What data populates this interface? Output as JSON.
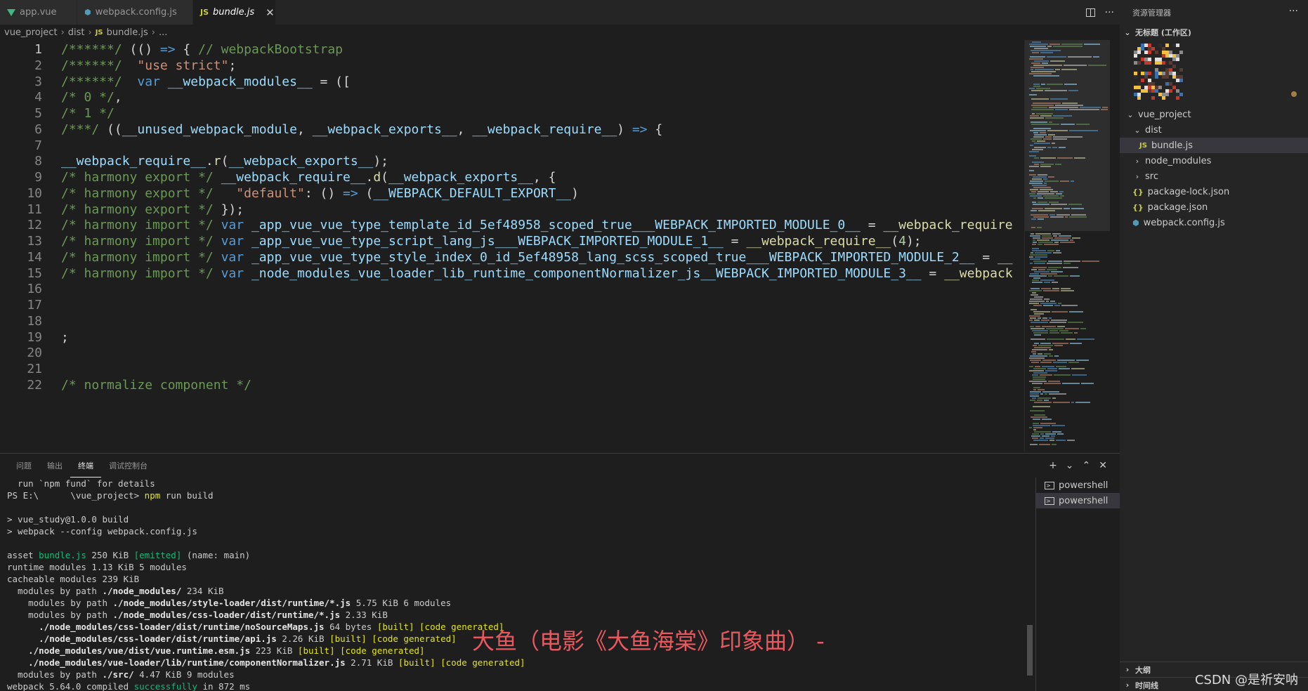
{
  "tabs": [
    {
      "label": "app.vue",
      "icon": "vue-icon",
      "active": false
    },
    {
      "label": "webpack.config.js",
      "icon": "webpack-icon",
      "active": false
    },
    {
      "label": "bundle.js",
      "icon": "js-icon",
      "active": true
    }
  ],
  "tab_actions": {
    "close_glyph": "✕",
    "more_glyph": "···"
  },
  "breadcrumb": {
    "items": [
      "vue_project",
      "dist",
      "bundle.js",
      "..."
    ],
    "file_icon": "JS",
    "sep": "›"
  },
  "editor": {
    "lines": [
      {
        "n": "1",
        "tokens": [
          [
            "cm",
            "/******/ "
          ],
          [
            "op",
            "(() "
          ],
          [
            "kw",
            "=>"
          ],
          [
            "op",
            " { "
          ],
          [
            "cm",
            "// webpackBootstrap"
          ]
        ]
      },
      {
        "n": "2",
        "tokens": [
          [
            "cm",
            "/******/ "
          ],
          [
            "op",
            " "
          ],
          [
            "str",
            "\"use strict\""
          ],
          [
            "op",
            ";"
          ]
        ]
      },
      {
        "n": "3",
        "tokens": [
          [
            "cm",
            "/******/ "
          ],
          [
            "op",
            " "
          ],
          [
            "kw",
            "var"
          ],
          [
            "op",
            " "
          ],
          [
            "var",
            "__webpack_modules__"
          ],
          [
            "op",
            " = (["
          ]
        ]
      },
      {
        "n": "4",
        "tokens": [
          [
            "cm",
            "/* 0 */"
          ],
          [
            "op",
            ","
          ]
        ]
      },
      {
        "n": "5",
        "tokens": [
          [
            "cm",
            "/* 1 */"
          ]
        ]
      },
      {
        "n": "6",
        "tokens": [
          [
            "cm",
            "/***/ "
          ],
          [
            "op",
            "(("
          ],
          [
            "var",
            "__unused_webpack_module"
          ],
          [
            "op",
            ", "
          ],
          [
            "var",
            "__webpack_exports__"
          ],
          [
            "op",
            ", "
          ],
          [
            "var",
            "__webpack_require__"
          ],
          [
            "op",
            ") "
          ],
          [
            "kw",
            "=>"
          ],
          [
            "op",
            " {"
          ]
        ]
      },
      {
        "n": "7",
        "tokens": []
      },
      {
        "n": "8",
        "tokens": [
          [
            "var",
            "__webpack_require__"
          ],
          [
            "op",
            "."
          ],
          [
            "fn",
            "r"
          ],
          [
            "op",
            "("
          ],
          [
            "var",
            "__webpack_exports__"
          ],
          [
            "op",
            ");"
          ]
        ]
      },
      {
        "n": "9",
        "tokens": [
          [
            "cm",
            "/* harmony export */ "
          ],
          [
            "var",
            "__webpack_require__"
          ],
          [
            "op",
            "."
          ],
          [
            "fn",
            "d"
          ],
          [
            "op",
            "("
          ],
          [
            "var",
            "__webpack_exports__"
          ],
          [
            "op",
            ", {"
          ]
        ]
      },
      {
        "n": "10",
        "tokens": [
          [
            "cm",
            "/* harmony export */ "
          ],
          [
            "op",
            "  "
          ],
          [
            "str",
            "\"default\""
          ],
          [
            "op",
            ": () "
          ],
          [
            "kw",
            "=>"
          ],
          [
            "op",
            " ("
          ],
          [
            "var",
            "__WEBPACK_DEFAULT_EXPORT__"
          ],
          [
            "op",
            ")"
          ]
        ]
      },
      {
        "n": "11",
        "tokens": [
          [
            "cm",
            "/* harmony export */ "
          ],
          [
            "op",
            "});"
          ]
        ]
      },
      {
        "n": "12",
        "tokens": [
          [
            "cm",
            "/* harmony import */ "
          ],
          [
            "kw",
            "var"
          ],
          [
            "op",
            " "
          ],
          [
            "var",
            "_app_vue_vue_type_template_id_5ef48958_scoped_true___WEBPACK_IMPORTED_MODULE_0__"
          ],
          [
            "op",
            " = "
          ],
          [
            "fn",
            "__webpack_require"
          ]
        ]
      },
      {
        "n": "13",
        "tokens": [
          [
            "cm",
            "/* harmony import */ "
          ],
          [
            "kw",
            "var"
          ],
          [
            "op",
            " "
          ],
          [
            "var",
            "_app_vue_vue_type_script_lang_js___WEBPACK_IMPORTED_MODULE_1__"
          ],
          [
            "op",
            " = "
          ],
          [
            "fn",
            "__webpack_require__"
          ],
          [
            "op",
            "("
          ],
          [
            "num",
            "4"
          ],
          [
            "op",
            ");"
          ]
        ]
      },
      {
        "n": "14",
        "tokens": [
          [
            "cm",
            "/* harmony import */ "
          ],
          [
            "kw",
            "var"
          ],
          [
            "op",
            " "
          ],
          [
            "var",
            "_app_vue_vue_type_style_index_0_id_5ef48958_lang_scss_scoped_true___WEBPACK_IMPORTED_MODULE_2__"
          ],
          [
            "op",
            " = "
          ],
          [
            "fn",
            "__"
          ]
        ]
      },
      {
        "n": "15",
        "tokens": [
          [
            "cm",
            "/* harmony import */ "
          ],
          [
            "kw",
            "var"
          ],
          [
            "op",
            " "
          ],
          [
            "var",
            "_node_modules_vue_loader_lib_runtime_componentNormalizer_js__WEBPACK_IMPORTED_MODULE_3__"
          ],
          [
            "op",
            " = "
          ],
          [
            "fn",
            "__webpack"
          ]
        ]
      },
      {
        "n": "16",
        "tokens": []
      },
      {
        "n": "17",
        "tokens": []
      },
      {
        "n": "18",
        "tokens": []
      },
      {
        "n": "19",
        "tokens": [
          [
            "op",
            ";"
          ]
        ]
      },
      {
        "n": "20",
        "tokens": []
      },
      {
        "n": "21",
        "tokens": []
      },
      {
        "n": "22",
        "tokens": [
          [
            "cm",
            "/* normalize component */"
          ]
        ]
      }
    ]
  },
  "panel": {
    "tabs": [
      "问题",
      "输出",
      "终端",
      "调试控制台"
    ],
    "active_tab": "终端",
    "actions": [
      "+",
      "⌄",
      "⌃",
      "✕"
    ],
    "terminal_lines": [
      [
        [
          "n",
          "  run `npm fund` for details"
        ]
      ]
    ],
    "terminal": [
      [
        [
          "n",
          "  run `npm fund` for details"
        ]
      ],
      [
        [
          "n",
          "PS E:\\"
        ],
        [
          "n",
          "      "
        ],
        [
          "n",
          "\\vue_project> "
        ],
        [
          "y",
          "npm"
        ],
        [
          "n",
          " run build"
        ]
      ],
      [
        [
          "n",
          ""
        ]
      ],
      [
        [
          "n",
          "> vue_study@1.0.0 build"
        ]
      ],
      [
        [
          "n",
          "> webpack --config webpack.config.js"
        ]
      ],
      [
        [
          "n",
          ""
        ]
      ],
      [
        [
          "n",
          "asset "
        ],
        [
          "g",
          "bundle.js"
        ],
        [
          "n",
          " 250 KiB "
        ],
        [
          "g",
          "[emitted]"
        ],
        [
          "n",
          " (name: main)"
        ]
      ],
      [
        [
          "n",
          "runtime modules 1.13 KiB 5 modules"
        ]
      ],
      [
        [
          "n",
          "cacheable modules 239 KiB"
        ]
      ],
      [
        [
          "n",
          "  modules by path "
        ],
        [
          "b",
          "./node_modules/"
        ],
        [
          "n",
          " 234 KiB"
        ]
      ],
      [
        [
          "n",
          "    modules by path "
        ],
        [
          "b",
          "./node_modules/style-loader/dist/runtime/*.js"
        ],
        [
          "n",
          " 5.75 KiB 6 modules"
        ]
      ],
      [
        [
          "n",
          "    modules by path "
        ],
        [
          "b",
          "./node_modules/css-loader/dist/runtime/*.js"
        ],
        [
          "n",
          " 2.33 KiB"
        ]
      ],
      [
        [
          "n",
          "      "
        ],
        [
          "b",
          "./node_modules/css-loader/dist/runtime/noSourceMaps.js"
        ],
        [
          "n",
          " 64 bytes "
        ],
        [
          "y",
          "[built] [code generated]"
        ]
      ],
      [
        [
          "n",
          "      "
        ],
        [
          "b",
          "./node_modules/css-loader/dist/runtime/api.js"
        ],
        [
          "n",
          " 2.26 KiB "
        ],
        [
          "y",
          "[built] [code generated]"
        ]
      ],
      [
        [
          "n",
          "    "
        ],
        [
          "b",
          "./node_modules/vue/dist/vue.runtime.esm.js"
        ],
        [
          "n",
          " 223 KiB "
        ],
        [
          "y",
          "[built] [code generated]"
        ]
      ],
      [
        [
          "n",
          "    "
        ],
        [
          "b",
          "./node_modules/vue-loader/lib/runtime/componentNormalizer.js"
        ],
        [
          "n",
          " 2.71 KiB "
        ],
        [
          "y",
          "[built] [code generated]"
        ]
      ],
      [
        [
          "n",
          "  modules by path "
        ],
        [
          "b",
          "./src/"
        ],
        [
          "n",
          " 4.47 KiB 9 modules"
        ]
      ],
      [
        [
          "n",
          "webpack 5.64.0 compiled "
        ],
        [
          "g",
          "successfully"
        ],
        [
          "n",
          " in 872 ms"
        ]
      ]
    ],
    "terminal_instances": [
      "powershell",
      "powershell"
    ],
    "overlay_caption": "大鱼（电影《大鱼海棠》印象曲） -"
  },
  "explorer": {
    "title": "资源管理器",
    "workspace": "无标题 (工作区)",
    "tree": [
      {
        "label": "vue_project",
        "depth": 1,
        "kind": "folder-open"
      },
      {
        "label": "dist",
        "depth": 2,
        "kind": "folder-open"
      },
      {
        "label": "bundle.js",
        "depth": 3,
        "kind": "js",
        "selected": true
      },
      {
        "label": "node_modules",
        "depth": 2,
        "kind": "folder-closed"
      },
      {
        "label": "src",
        "depth": 2,
        "kind": "folder-closed"
      },
      {
        "label": "package-lock.json",
        "depth": 2,
        "kind": "json"
      },
      {
        "label": "package.json",
        "depth": 2,
        "kind": "json"
      },
      {
        "label": "webpack.config.js",
        "depth": 2,
        "kind": "webpack"
      }
    ],
    "outline": "大纲",
    "timeline": "时间线"
  },
  "watermark": "CSDN @是祈安呐",
  "colors": {
    "comment": "#6a9955",
    "keyword": "#569cd6",
    "string": "#ce9178",
    "variable": "#9cdcfe",
    "function": "#dcdcaa",
    "caption": "#e8585f"
  }
}
